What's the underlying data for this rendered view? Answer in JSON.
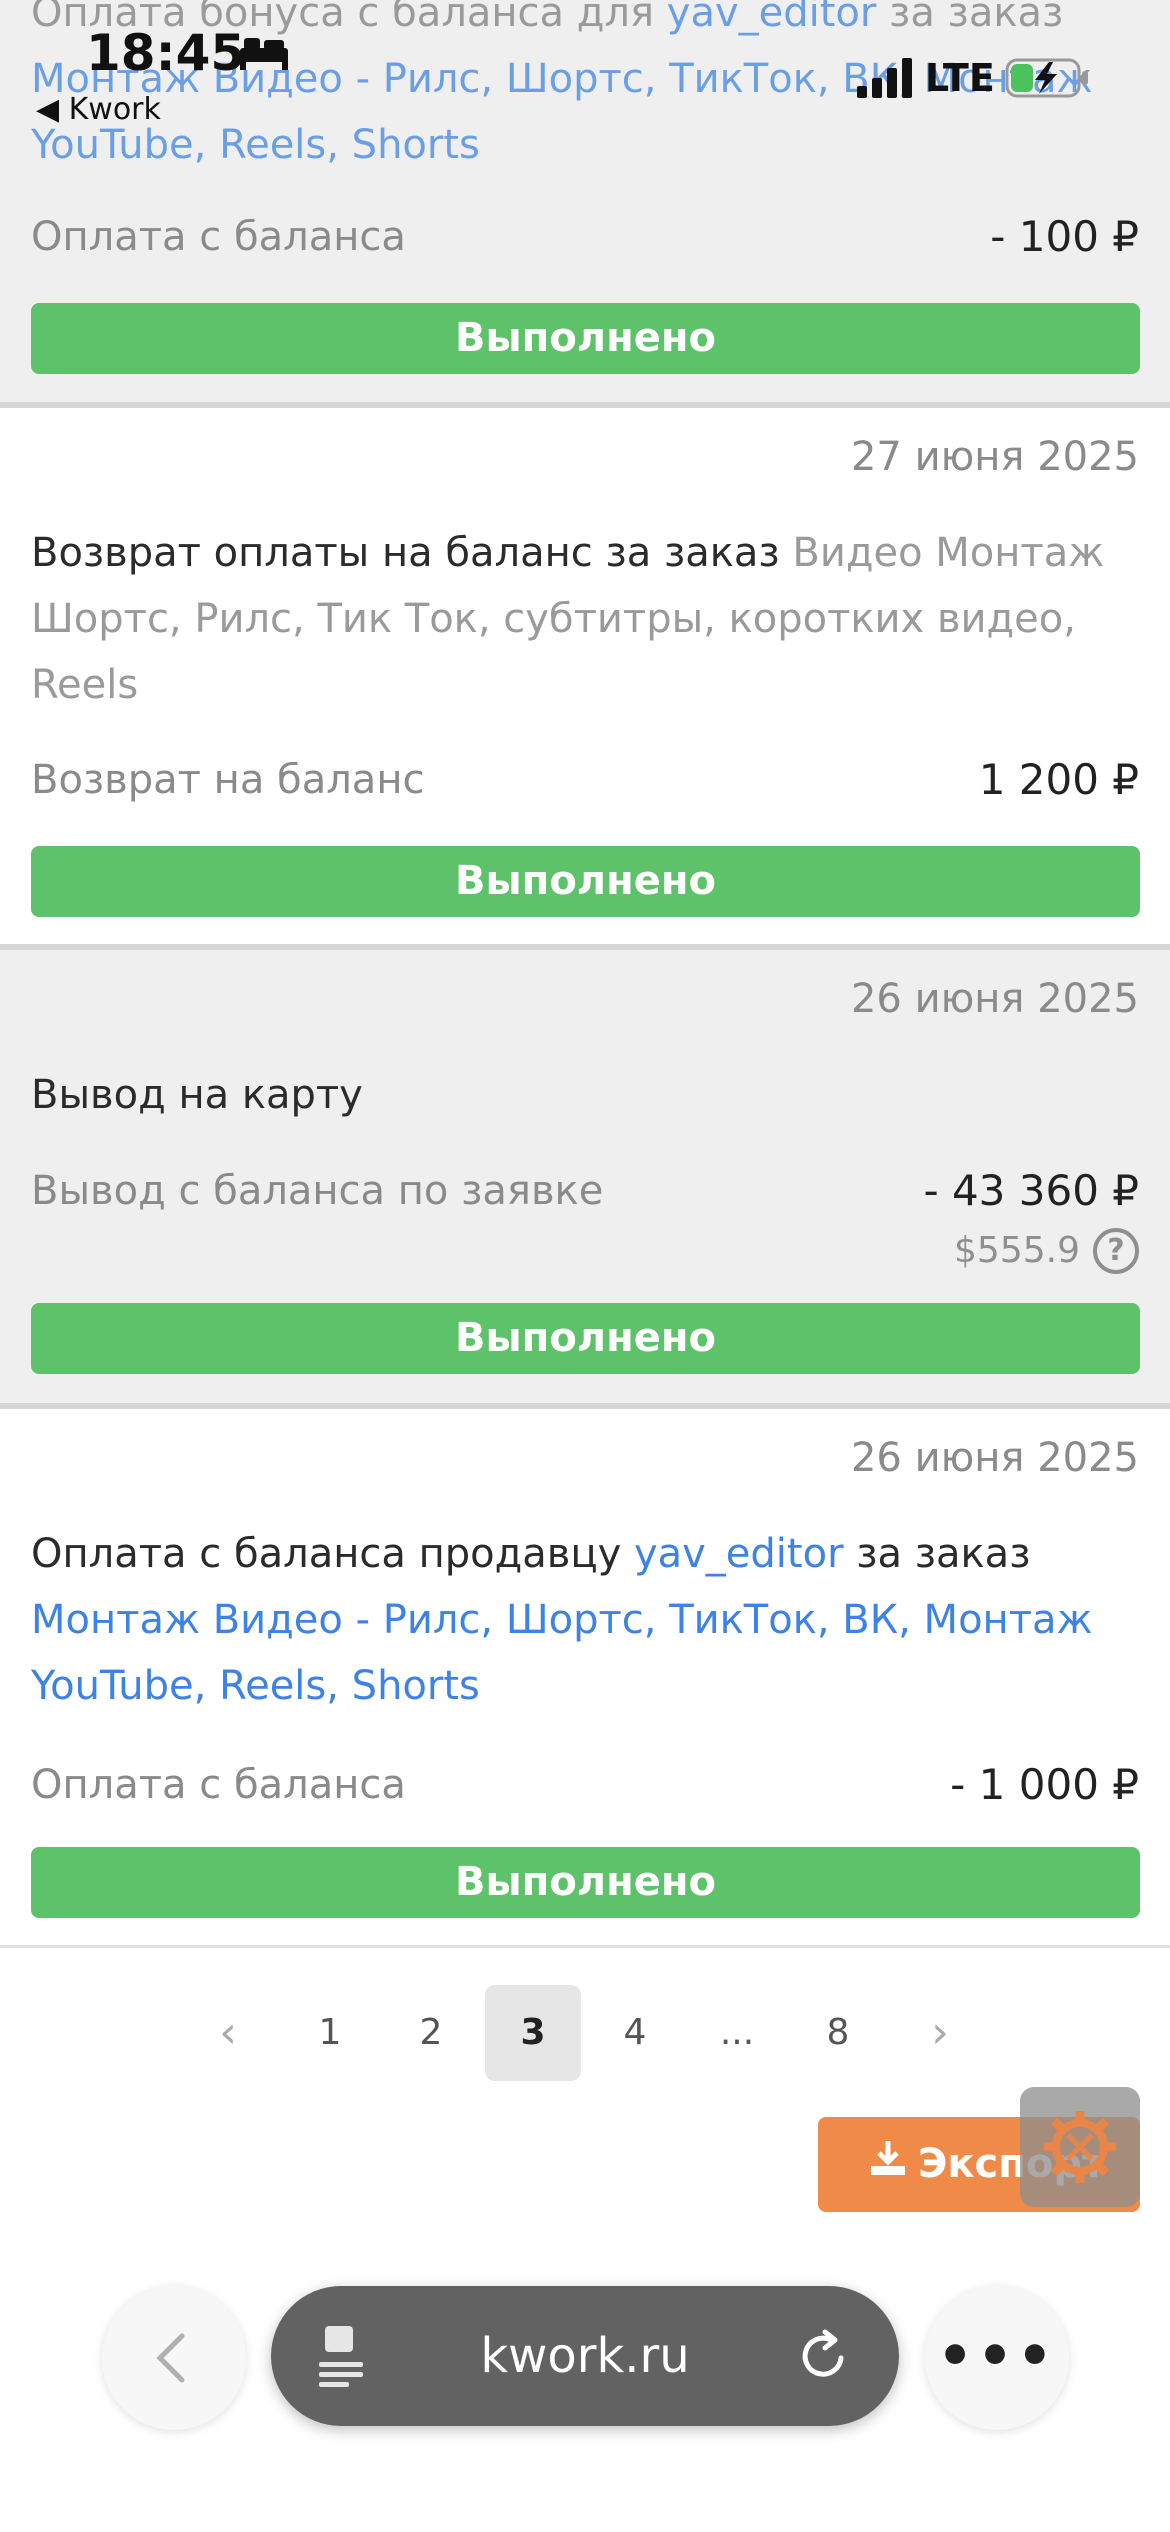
{
  "status_bar": {
    "time": "18:45",
    "back_app": "◀ Kwork",
    "network": "LTE"
  },
  "transactions": [
    {
      "description_parts": [
        {
          "text": "Оплата бонуса с баланса для ",
          "style": "muted"
        },
        {
          "text": "yav_editor",
          "style": "link"
        },
        {
          "text": " за заказ ",
          "style": "muted"
        },
        {
          "text": "Монтаж Видео - Рилс, Шортс, ТикТок, ВК, Монтаж YouTube, Reels, Shorts",
          "style": "link"
        }
      ],
      "label": "Оплата с баланса",
      "amount": "- 100 ₽",
      "status": "Выполнено"
    },
    {
      "date": "27 июня 2025",
      "description_parts": [
        {
          "text": "Возврат оплаты на баланс за заказ ",
          "style": "plain"
        },
        {
          "text": "Видео Монтаж Шортс, Рилс, Тик Ток, субтитры, коротких видео, Reels",
          "style": "muted"
        }
      ],
      "label": "Возврат на баланс",
      "amount": "1 200 ₽",
      "status": "Выполнено"
    },
    {
      "date": "26 июня 2025",
      "description_parts": [
        {
          "text": "Вывод на карту",
          "style": "plain"
        }
      ],
      "label": "Вывод с баланса по заявке",
      "amount": "- 43 360 ₽",
      "usd": "$555.9",
      "status": "Выполнено"
    },
    {
      "date": "26 июня 2025",
      "description_parts": [
        {
          "text": "Оплата с баланса продавцу ",
          "style": "plain"
        },
        {
          "text": "yav_editor",
          "style": "link"
        },
        {
          "text": " за заказ ",
          "style": "plain"
        },
        {
          "text": "Монтаж Видео - Рилс, Шортс, ТикТок, ВК, Монтаж YouTube, Reels, Shorts",
          "style": "link"
        }
      ],
      "label": "Оплата с баланса",
      "amount": "- 1 000 ₽",
      "status": "Выполнено"
    }
  ],
  "pagination": {
    "prev": "‹",
    "pages": [
      "1",
      "2",
      "3",
      "4",
      "...",
      "8"
    ],
    "current": "3",
    "next": "›"
  },
  "export_label": "Экспорт",
  "browser": {
    "url": "kwork.ru"
  },
  "colors": {
    "status_green": "#5ec26a",
    "link_blue": "#3d82e6",
    "export_orange": "#ef8a48"
  }
}
